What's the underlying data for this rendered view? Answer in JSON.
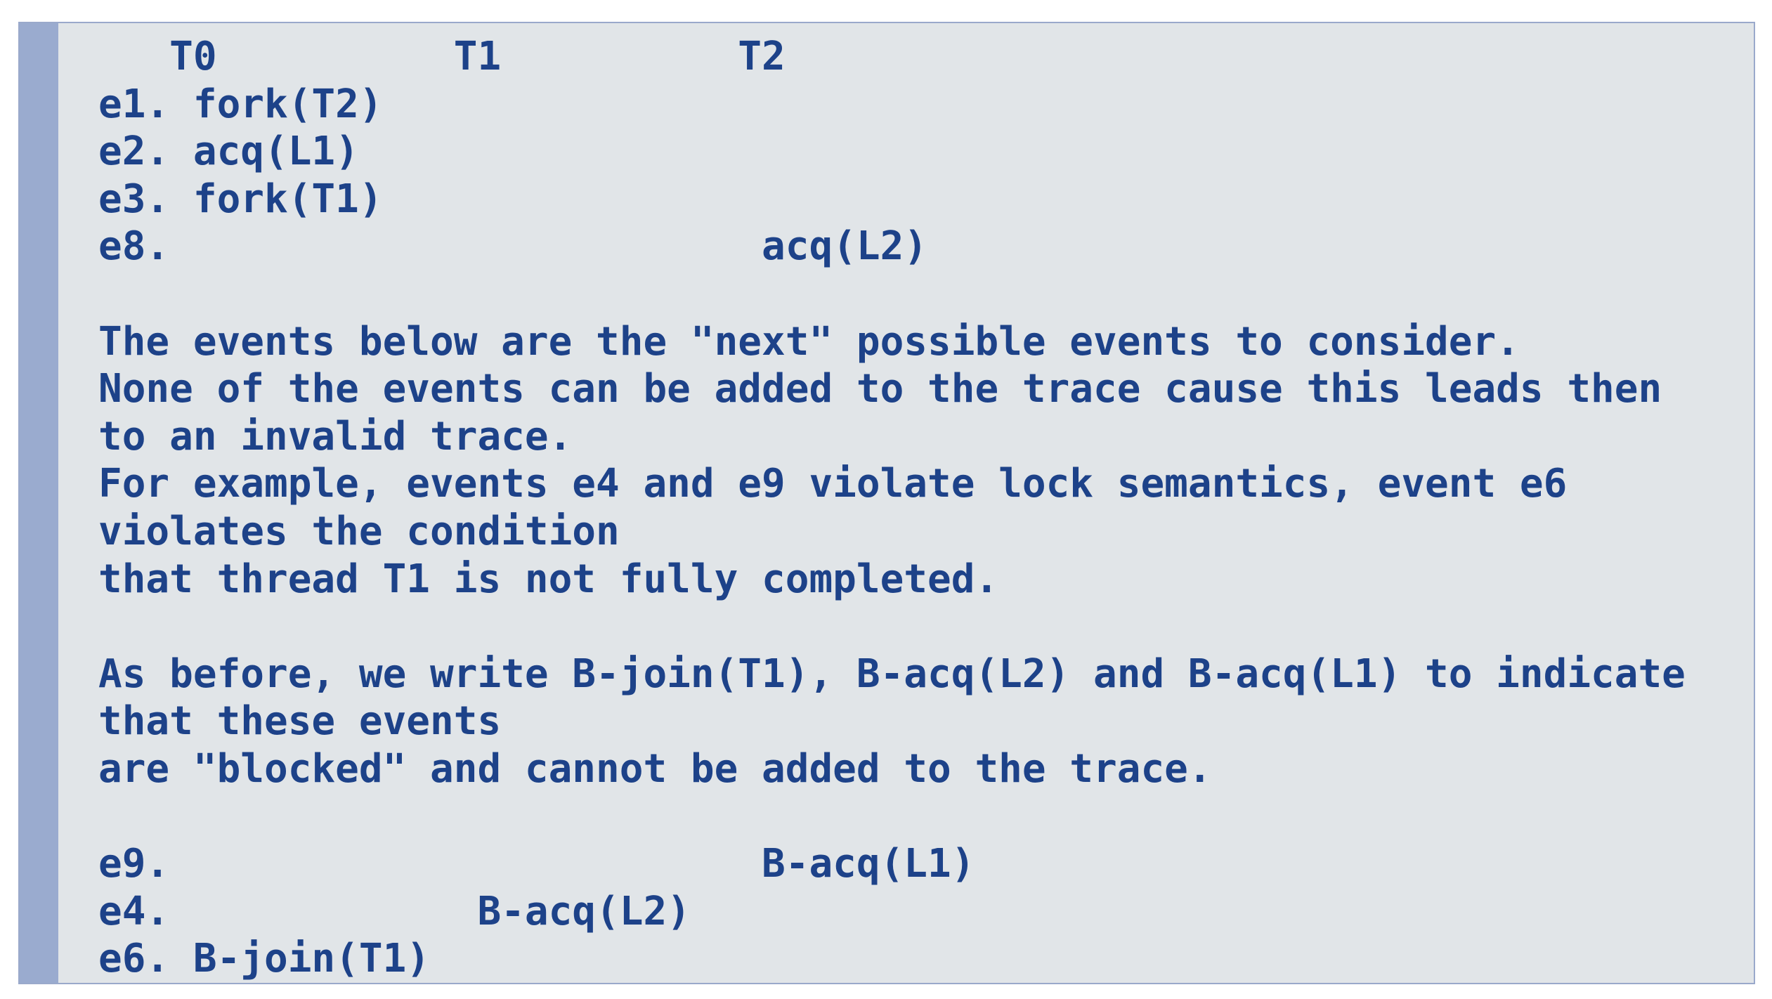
{
  "colors": {
    "text": "#1d4289",
    "background": "#e1e5e8",
    "accent_bar": "#9aabcf",
    "border": "#9aa9cb"
  },
  "lines": [
    "   T0          T1          T2",
    "e1. fork(T2)",
    "e2. acq(L1)",
    "e3. fork(T1)",
    "e8.                         acq(L2)",
    "",
    "The events below are the \"next\" possible events to consider.",
    "None of the events can be added to the trace cause this leads then",
    "to an invalid trace.",
    "For example, events e4 and e9 violate lock semantics, event e6",
    "violates the condition",
    "that thread T1 is not fully completed.",
    "",
    "As before, we write B-join(T1), B-acq(L2) and B-acq(L1) to indicate",
    "that these events",
    "are \"blocked\" and cannot be added to the trace.",
    "",
    "e9.                         B-acq(L1)",
    "e4.             B-acq(L2)",
    "e6. B-join(T1)"
  ]
}
